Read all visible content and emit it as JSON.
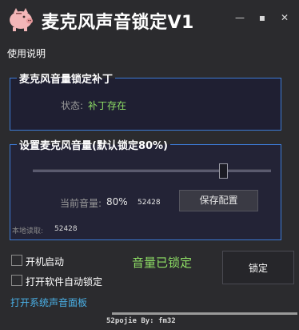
{
  "window": {
    "title": "麦克风声音锁定V1",
    "minimize_symbol": "—",
    "maximize_symbol": "▪",
    "close_symbol": "✕"
  },
  "menu": {
    "help_label": "使用说明"
  },
  "patch_group": {
    "title": "麦克风音量锁定补丁",
    "status_label": "状态:",
    "status_value": "补丁存在"
  },
  "volume_group": {
    "title": "设置麦克风音量(默认锁定80%)",
    "slider_value_percent": 80,
    "current_label": "当前音量:",
    "current_value": "80%",
    "raw_value": "52428",
    "save_button": "保存配置",
    "local_read_label": "本地读取:",
    "local_read_value": "52428"
  },
  "options": {
    "autostart_label": "开机启动",
    "autolock_label": "打开软件自动锁定",
    "autostart_checked": false,
    "autolock_checked": false
  },
  "lock": {
    "status_text": "音量已锁定",
    "button_label": "锁定"
  },
  "sound_panel_link": "打开系统声音面板",
  "footer": {
    "credit": "52pojie By: fm32"
  },
  "colors": {
    "background": "#2b2b2e",
    "accent_blue": "#3d7bd6",
    "status_green": "#8fe066",
    "link_blue": "#4ab0e6"
  },
  "icons": {
    "logo": "piggy-bank-icon"
  }
}
